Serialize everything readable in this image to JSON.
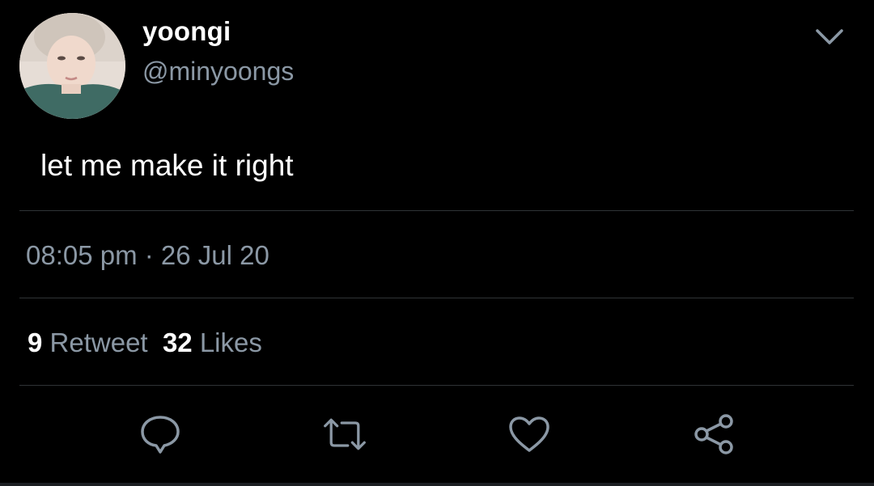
{
  "user": {
    "display_name": "yoongi",
    "handle": "@minyoongs"
  },
  "tweet": {
    "text": "let me make it right",
    "time": "08:05 pm",
    "separator": " · ",
    "date": "26 Jul 20"
  },
  "stats": {
    "retweets": "9",
    "retweet_label": "Retweet",
    "likes": "32",
    "likes_label": "Likes"
  },
  "icons": {
    "more": "chevron-down-icon",
    "reply": "comment-bubble-icon",
    "retweet": "retweet-icon",
    "like": "heart-icon",
    "share": "share-icon"
  },
  "colors": {
    "background": "#000000",
    "text_primary": "#ffffff",
    "text_secondary": "#8b98a5",
    "divider": "#2f3336"
  }
}
